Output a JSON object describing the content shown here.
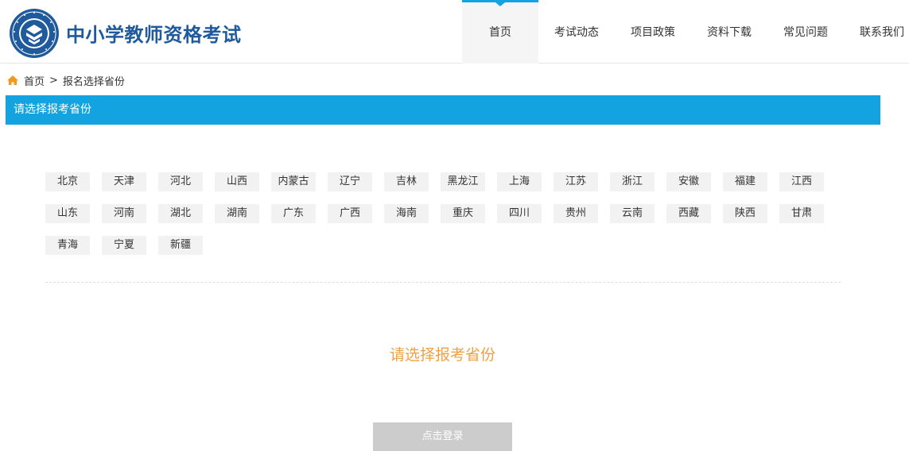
{
  "header": {
    "site_title": "中小学教师资格考试",
    "logo_icon": "teacher-certification-seal-icon",
    "nav": [
      {
        "label": "首页",
        "active": true
      },
      {
        "label": "考试动态",
        "active": false
      },
      {
        "label": "项目政策",
        "active": false
      },
      {
        "label": "资料下载",
        "active": false
      },
      {
        "label": "常见问题",
        "active": false
      },
      {
        "label": "联系我们",
        "active": false
      }
    ]
  },
  "breadcrumb": {
    "home_icon": "home-icon",
    "home": "首页",
    "separator": ">",
    "current": "报名选择省份"
  },
  "section": {
    "title": "请选择报考省份"
  },
  "provinces": [
    "北京",
    "天津",
    "河北",
    "山西",
    "内蒙古",
    "辽宁",
    "吉林",
    "黑龙江",
    "上海",
    "江苏",
    "浙江",
    "安徽",
    "福建",
    "江西",
    "山东",
    "河南",
    "湖北",
    "湖南",
    "广东",
    "广西",
    "海南",
    "重庆",
    "四川",
    "贵州",
    "云南",
    "西藏",
    "陕西",
    "甘肃",
    "青海",
    "宁夏",
    "新疆"
  ],
  "prompt": "请选择报考省份",
  "login_button": "点击登录",
  "colors": {
    "accent": "#12a3e0",
    "title": "#1f5a9c",
    "prompt": "#f0a042",
    "button_disabled": "#cccccc",
    "province_bg": "#f2f2f2"
  }
}
